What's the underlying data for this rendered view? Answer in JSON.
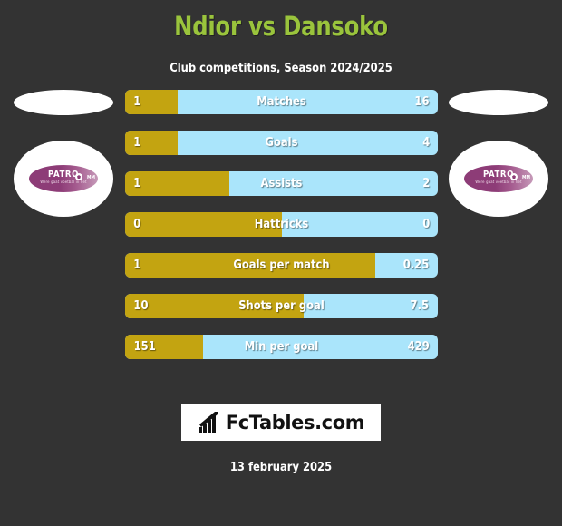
{
  "header": {
    "title": "Ndior vs Dansoko",
    "subtitle": "Club competitions, Season 2024/2025",
    "title_color": "#9ac43c"
  },
  "colors": {
    "background": "#333333",
    "home_bar": "#c3a411",
    "away_bar": "#aae5fb",
    "badge_purple": "#8d3c77",
    "text": "#ffffff"
  },
  "players": {
    "left": {
      "photo_name": "player-photo-placeholder",
      "club_badge_text": "PATRO",
      "club_badge_sub": "Were gaat voetbal in het"
    },
    "right": {
      "photo_name": "player-photo-placeholder",
      "club_badge_text": "PATRO",
      "club_badge_sub": "Were gaat voetbal in het"
    }
  },
  "chart_data": {
    "type": "bar",
    "title": "Ndior vs Dansoko",
    "subtitle": "Club competitions, Season 2024/2025",
    "orientation": "horizontal-diverging",
    "series": [
      {
        "name": "Ndior",
        "color": "#c3a411"
      },
      {
        "name": "Dansoko",
        "color": "#aae5fb"
      }
    ],
    "categories": [
      "Matches",
      "Goals",
      "Assists",
      "Hattricks",
      "Goals per match",
      "Shots per goal",
      "Min per goal"
    ],
    "rows": [
      {
        "label": "Matches",
        "home": "1",
        "away": "16",
        "home_pct": 16.8
      },
      {
        "label": "Goals",
        "home": "1",
        "away": "4",
        "home_pct": 16.8
      },
      {
        "label": "Assists",
        "home": "1",
        "away": "2",
        "home_pct": 33.3
      },
      {
        "label": "Hattricks",
        "home": "0",
        "away": "0",
        "home_pct": 50.0
      },
      {
        "label": "Goals per match",
        "home": "1",
        "away": "0.25",
        "home_pct": 80.0
      },
      {
        "label": "Shots per goal",
        "home": "10",
        "away": "7.5",
        "home_pct": 57.1
      },
      {
        "label": "Min per goal",
        "home": "151",
        "away": "429",
        "home_pct": 25.0
      }
    ]
  },
  "footer": {
    "logo_text": "FcTables.com",
    "logo_icon": "bar-chart-icon",
    "date": "13 february 2025"
  }
}
